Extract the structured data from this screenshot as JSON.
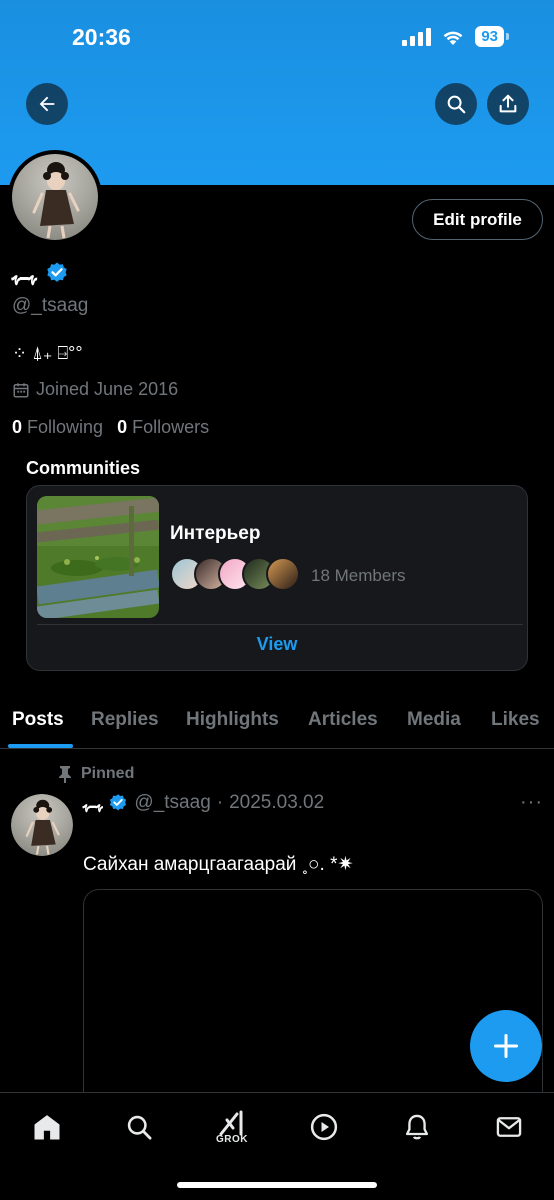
{
  "status_bar": {
    "time": "20:36",
    "battery": "93"
  },
  "header": {
    "icons": [
      "back-arrow-icon",
      "search-icon",
      "share-icon"
    ]
  },
  "profile": {
    "name": "ﮩـ‌ﮩ",
    "handle": "@_tsaag",
    "bio": "⁘ ⍋₊ ⍈°°",
    "joined": "Joined June 2016",
    "following_count": "0",
    "following_label": "Following",
    "followers_count": "0",
    "followers_label": "Followers",
    "edit_button": "Edit profile",
    "colors": {
      "verified": "#1d9bf0",
      "banner": "#1d9bf0"
    }
  },
  "communities": {
    "heading": "Communities",
    "name": "Интерьер",
    "members": "18 Members",
    "view_label": "View"
  },
  "tabs": [
    "Posts",
    "Replies",
    "Highlights",
    "Articles",
    "Media",
    "Likes"
  ],
  "active_tab": "Posts",
  "pinned_post": {
    "pinned_label": "Pinned",
    "author_name": "ﮩـ‌ﮩ",
    "handle": "@_tsaag",
    "date": "2025.03.02",
    "separator": "·",
    "text": "Сайхан амарцгаагаарай ˳○. *✷"
  },
  "bottom_nav": {
    "items": [
      "home-icon",
      "search-icon",
      "grok-icon",
      "video-icon",
      "notifications-icon",
      "messages-icon"
    ],
    "grok_label": "GROK"
  },
  "accent_color": "#1d9bf0"
}
